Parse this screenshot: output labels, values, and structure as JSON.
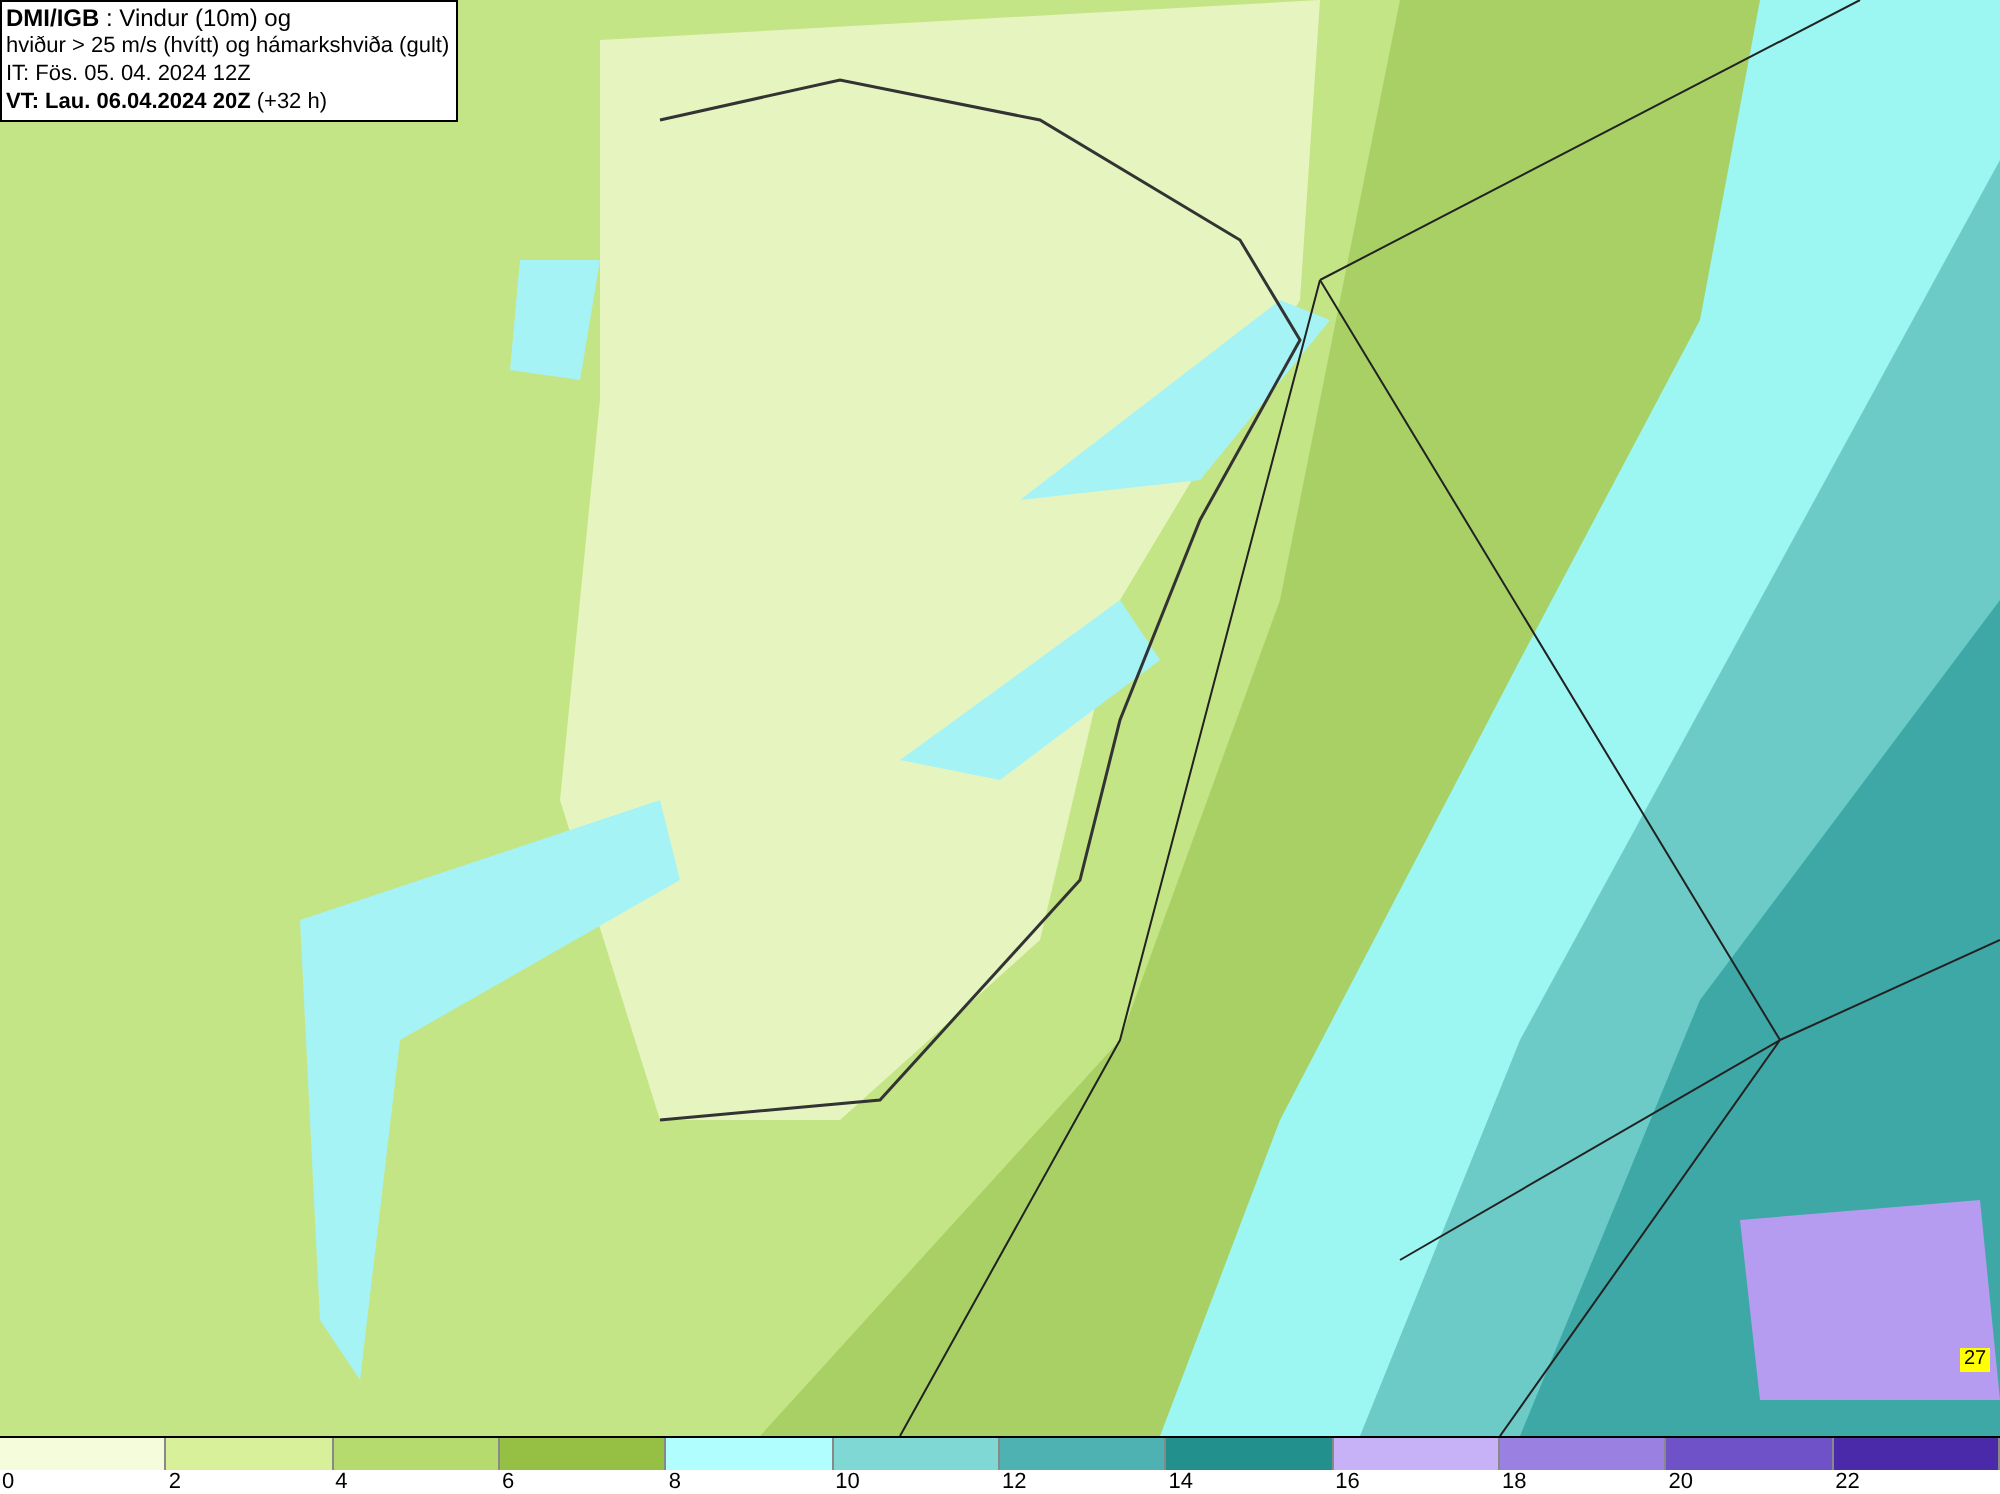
{
  "info": {
    "lines": [
      "**DMI/IGB** : Vindur (10m) og",
      "hviður > 25 m/s (hvítt) og hámarkshviða (gult)",
      "IT: Fös. 05. 04. 2024 12Z",
      "**VT: Lau. 06.04.2024 20Z** (+32 h)"
    ]
  },
  "gust_label": "27",
  "legend": [
    {
      "label": "0",
      "color": "#f5fcdc"
    },
    {
      "label": "2",
      "color": "#d8f09a"
    },
    {
      "label": "4",
      "color": "#b5db6e"
    },
    {
      "label": "6",
      "color": "#96c044"
    },
    {
      "label": "8",
      "color": "#b0fffe"
    },
    {
      "label": "10",
      "color": "#7fd8d4"
    },
    {
      "label": "12",
      "color": "#4fb2b2"
    },
    {
      "label": "14",
      "color": "#22918e"
    },
    {
      "label": "16",
      "color": "#c7b2f8"
    },
    {
      "label": "18",
      "color": "#9a80e0"
    },
    {
      "label": "20",
      "color": "#6f52c8"
    },
    {
      "label": "22",
      "color": "#4a2aa8"
    }
  ]
}
